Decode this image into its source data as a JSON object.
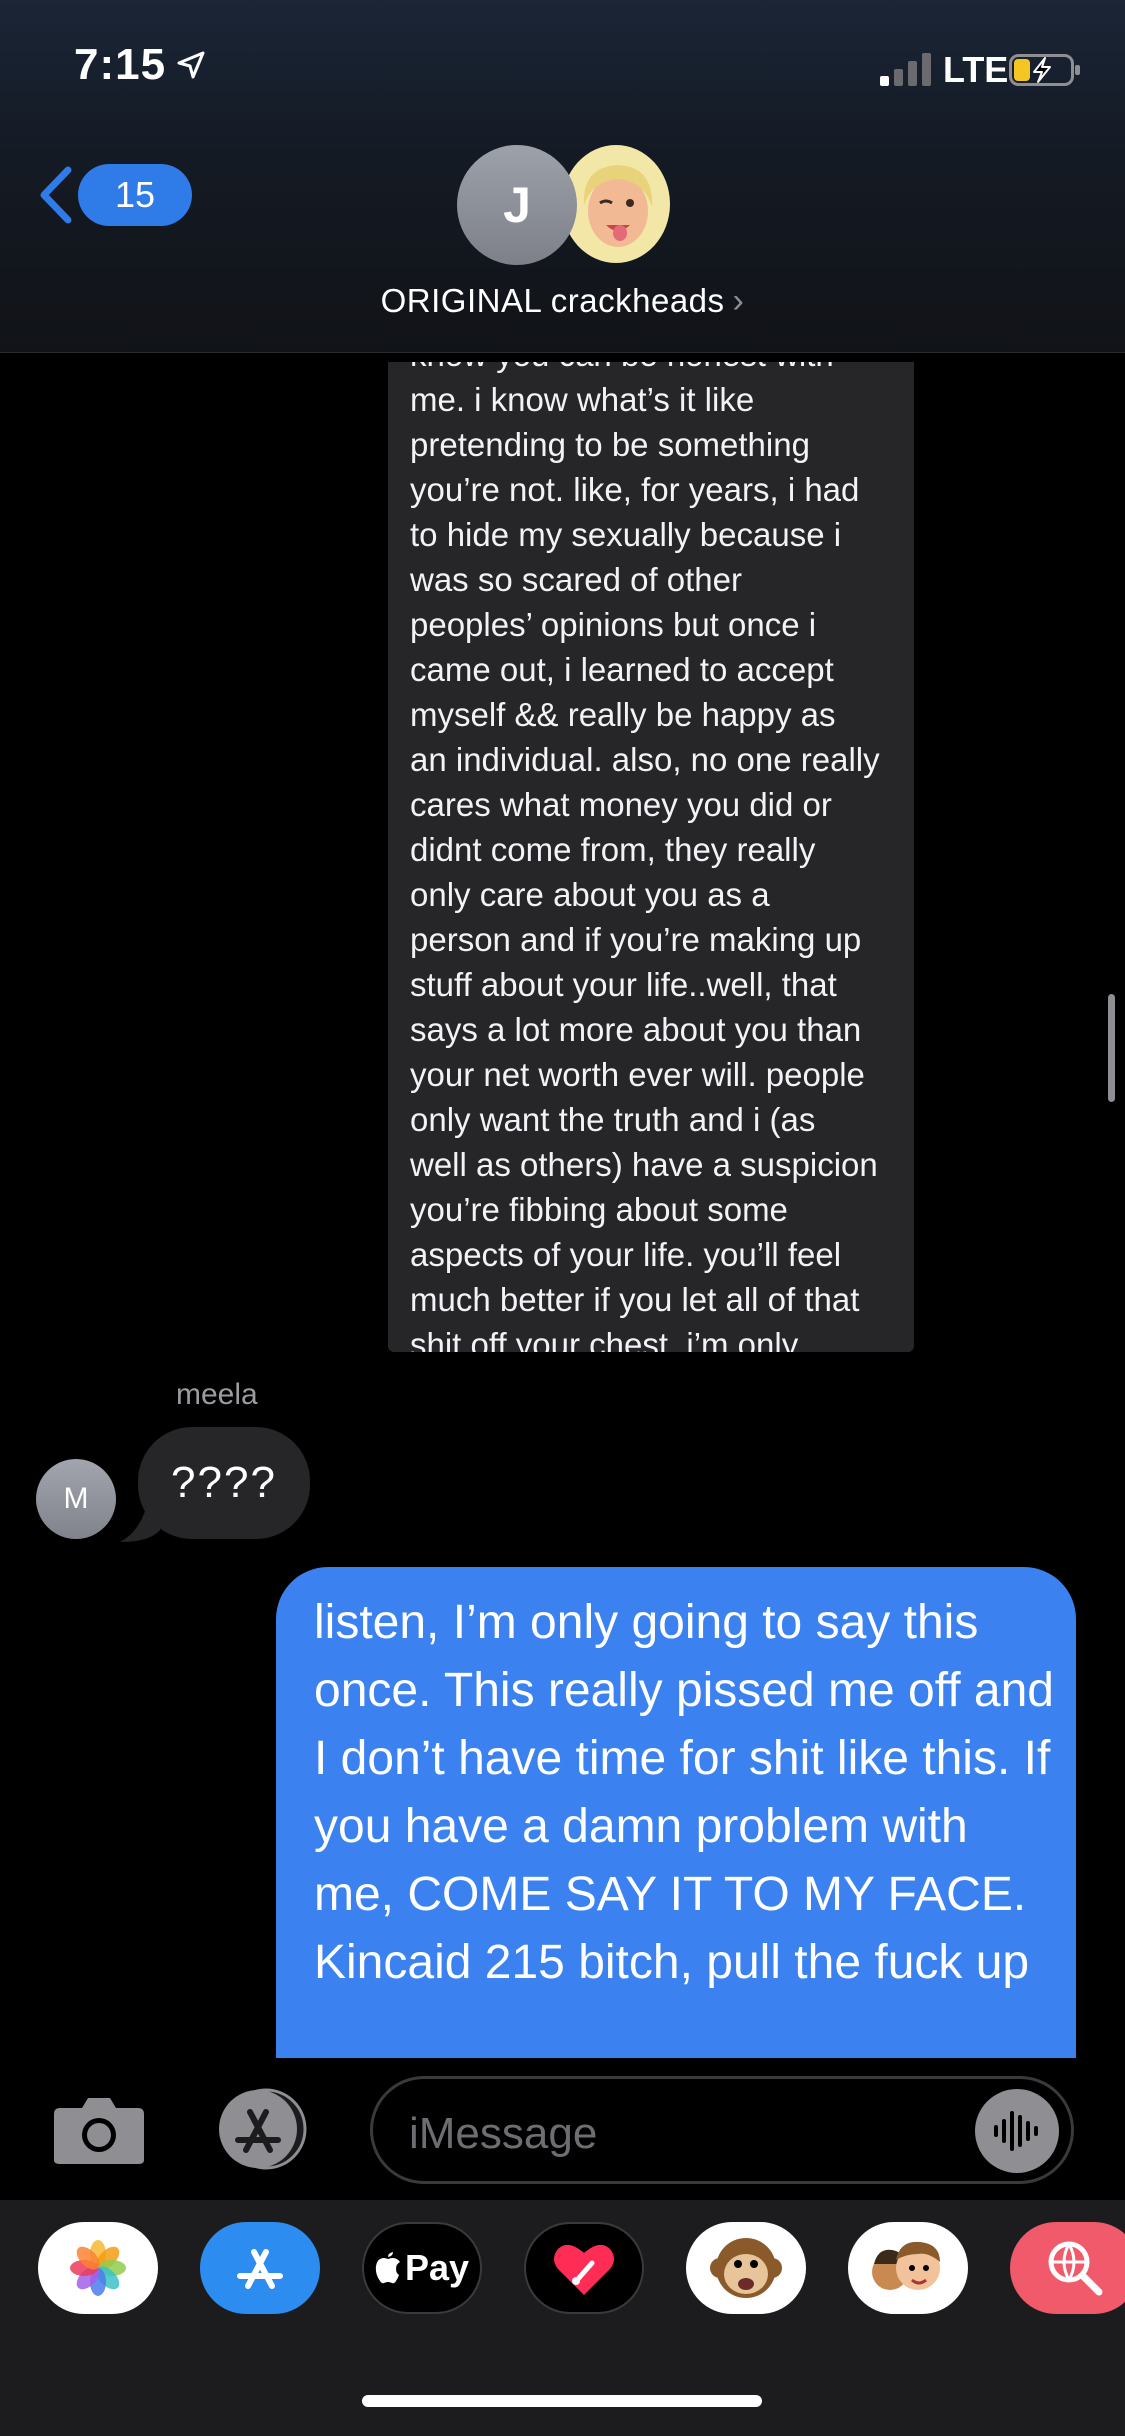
{
  "status_bar": {
    "time": "7:15",
    "network": "LTE"
  },
  "header": {
    "back_count": "15",
    "avatar_initial": "J",
    "group_name": "ORIGINAL crackheads",
    "group_chevron": "›"
  },
  "messages": {
    "long_incoming": "know you can be honest with\nme. i know what’s it like\npretending to be something\nyou’re not. like, for years, i had\nto hide my sexually because i\nwas so scared of other\npeoples’ opinions but once i\ncame out, i learned to accept\nmyself && really be happy as\nan individual. also, no one really\ncares what money you did or\ndidnt come from, they really\nonly care about you as a\nperson and if you’re making up\nstuff about your life..well, that\nsays a lot more about you than\nyour net worth ever will. people\nonly want the truth and i (as\nwell as others) have a suspicion\nyou’re fibbing about some\naspects of your life. you’ll feel\nmuch better if you let all of that\nshit off your chest. i’m only",
    "sender_name": "meela",
    "sender_initial": "M",
    "short_incoming": "????",
    "outgoing": "listen, I’m only going to say this once. This really pissed me off and I don’t have time for shit like this. If you have a damn problem with me, COME SAY IT TO MY FACE. Kincaid 215 bitch, pull the fuck up"
  },
  "input": {
    "placeholder": "iMessage"
  },
  "app_drawer": {
    "apple_pay_label": "Pay",
    "apps": [
      "photos-icon",
      "app-store-icon",
      "apple-pay-icon",
      "digital-touch-icon",
      "animoji-monkey-icon",
      "memoji-stickers-icon",
      "web-search-icon"
    ]
  },
  "colors": {
    "accent_blue": "#3b82f0",
    "incoming_bubble": "#262628",
    "background": "#000000"
  }
}
